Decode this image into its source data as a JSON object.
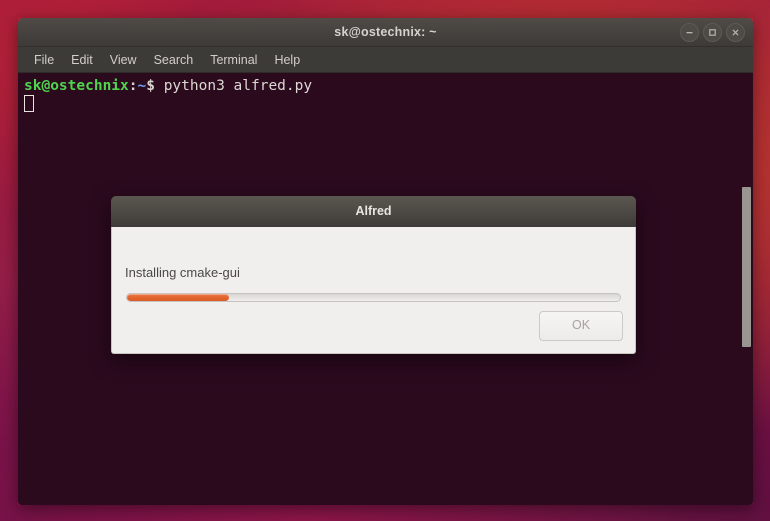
{
  "desktop": {
    "wallpaper_colors": [
      "#a5173f",
      "#8e1847",
      "#5c0c3f",
      "#c43a24"
    ]
  },
  "terminal": {
    "title": "sk@ostechnix: ~",
    "menu": [
      {
        "label": "File"
      },
      {
        "label": "Edit"
      },
      {
        "label": "View"
      },
      {
        "label": "Search"
      },
      {
        "label": "Terminal"
      },
      {
        "label": "Help"
      }
    ],
    "window_controls": [
      {
        "name": "minimize",
        "glyph": "–"
      },
      {
        "name": "maximize",
        "glyph": "□"
      },
      {
        "name": "close",
        "glyph": "×"
      }
    ],
    "prompt": {
      "user_host": "sk@ostechnix",
      "separator": ":",
      "path": "~",
      "dollar": "$",
      "command": " python3 alfred.py"
    },
    "background_color": "#2b0a1e",
    "prompt_color": "#4fd44f",
    "scrollbar_color": "#9a9590"
  },
  "dialog": {
    "title": "Alfred",
    "message": "Installing cmake-gui",
    "progress_percent": 20.6,
    "progress_fill_color": "#e4662f",
    "ok_button": {
      "label": "OK",
      "disabled": true
    }
  }
}
